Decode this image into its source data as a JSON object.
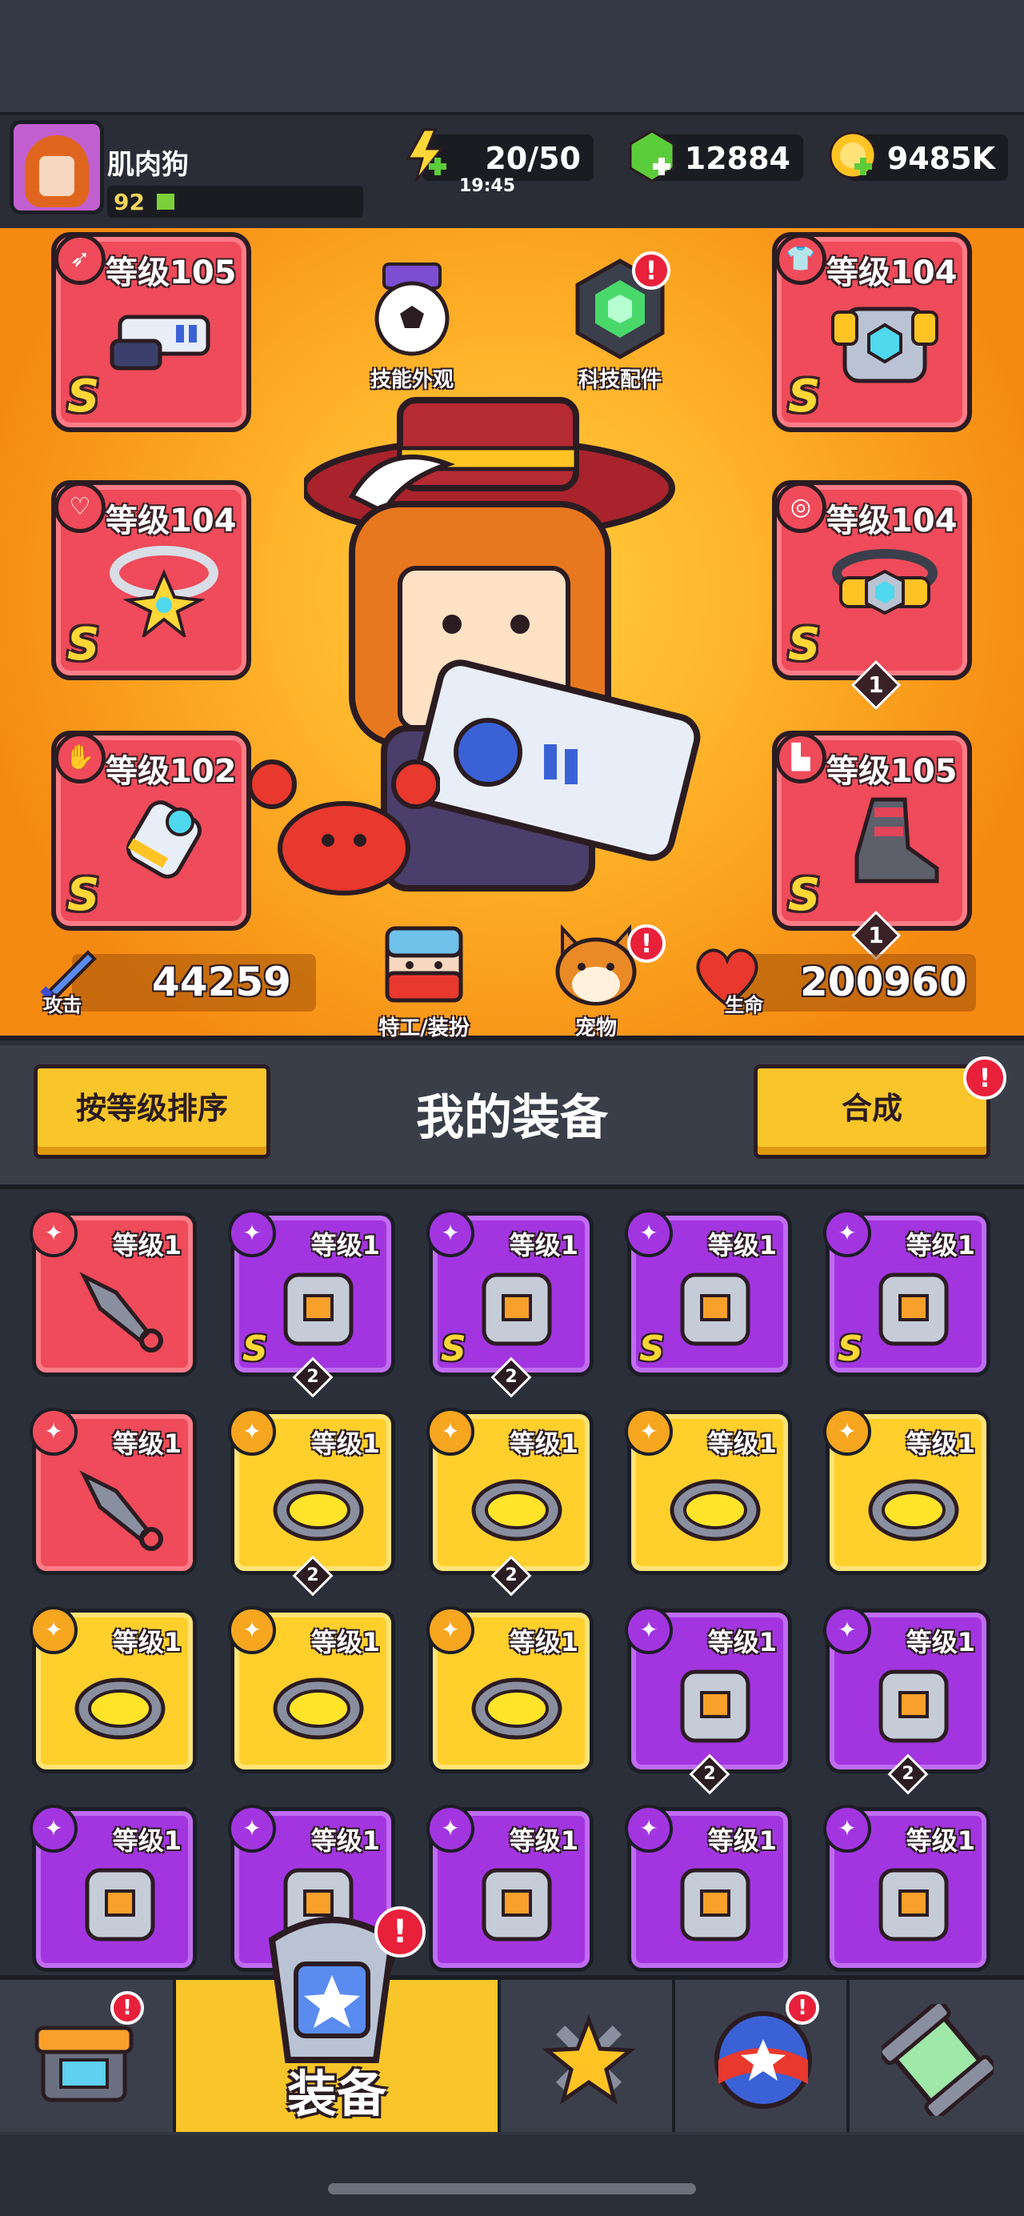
{
  "player": {
    "name": "肌肉狗",
    "level": "92"
  },
  "resources": {
    "energy": "20/50",
    "energy_timer": "19:45",
    "gems": "12884",
    "coins": "9485K"
  },
  "equipped": {
    "left": [
      {
        "level": "等级105",
        "grade": "S"
      },
      {
        "level": "等级104",
        "grade": "S"
      },
      {
        "level": "等级102",
        "grade": "S"
      }
    ],
    "right": [
      {
        "level": "等级104",
        "grade": "S"
      },
      {
        "level": "等级104",
        "grade": "S",
        "stars": "1"
      },
      {
        "level": "等级105",
        "grade": "S",
        "stars": "1"
      }
    ]
  },
  "stage_buttons": {
    "skill_skin": "技能外观",
    "tech_parts": "科技配件",
    "agent_outfit": "特工/装扮",
    "pet": "宠物",
    "alert_mark": "!"
  },
  "stats": {
    "attack_label": "攻击",
    "attack_value": "44259",
    "hp_label": "生命",
    "hp_value": "200960"
  },
  "inventory": {
    "sort_button": "按等级排序",
    "title": "我的装备",
    "merge_button": "合成",
    "items": [
      {
        "level": "等级1",
        "rarity": "red"
      },
      {
        "level": "等级1",
        "rarity": "purple",
        "grade": "S",
        "count": "2"
      },
      {
        "level": "等级1",
        "rarity": "purple",
        "grade": "S",
        "count": "2"
      },
      {
        "level": "等级1",
        "rarity": "purple",
        "grade": "S"
      },
      {
        "level": "等级1",
        "rarity": "purple",
        "grade": "S"
      },
      {
        "level": "等级1",
        "rarity": "red"
      },
      {
        "level": "等级1",
        "rarity": "yellow",
        "count": "2"
      },
      {
        "level": "等级1",
        "rarity": "yellow",
        "count": "2"
      },
      {
        "level": "等级1",
        "rarity": "yellow"
      },
      {
        "level": "等级1",
        "rarity": "yellow"
      },
      {
        "level": "等级1",
        "rarity": "yellow"
      },
      {
        "level": "等级1",
        "rarity": "yellow"
      },
      {
        "level": "等级1",
        "rarity": "yellow"
      },
      {
        "level": "等级1",
        "rarity": "purple",
        "count": "2"
      },
      {
        "level": "等级1",
        "rarity": "purple",
        "count": "2"
      },
      {
        "level": "等级1",
        "rarity": "purple"
      },
      {
        "level": "等级1",
        "rarity": "purple"
      },
      {
        "level": "等级1",
        "rarity": "purple"
      },
      {
        "level": "等级1",
        "rarity": "purple"
      },
      {
        "level": "等级1",
        "rarity": "purple"
      }
    ]
  },
  "nav": {
    "equipment_label": "装备"
  },
  "colors": {
    "stage_orange": "#f58a12",
    "red_slot": "#ef4b5a",
    "purple_slot": "#a235e0",
    "yellow_slot": "#ffd02c"
  }
}
